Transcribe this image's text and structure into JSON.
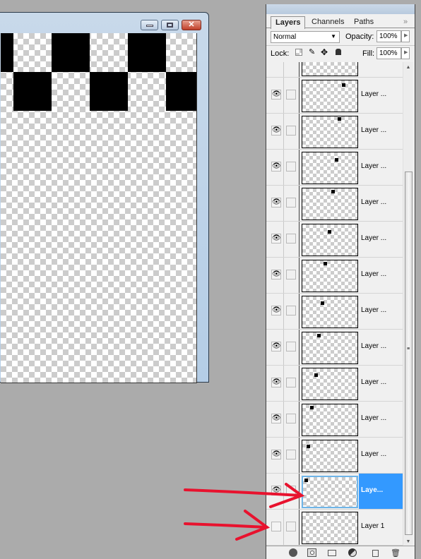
{
  "document_window": {
    "controls": {
      "minimize": "minimize-icon",
      "restore": "restore-icon",
      "close": "close-icon"
    },
    "canvas_pattern": "checkerboard black squares on transparency"
  },
  "layers_panel": {
    "tabs": [
      {
        "label": "Layers",
        "active": true
      },
      {
        "label": "Channels",
        "active": false
      },
      {
        "label": "Paths",
        "active": false
      }
    ],
    "menu_icon": "»",
    "blend_mode": "Normal",
    "opacity_label": "Opacity:",
    "opacity_value": "100%",
    "lock_label": "Lock:",
    "fill_label": "Fill:",
    "fill_value": "100%",
    "layers": [
      {
        "name": "Layer ...",
        "visible": true,
        "selected": false
      },
      {
        "name": "Layer ...",
        "visible": true,
        "selected": false
      },
      {
        "name": "Layer ...",
        "visible": true,
        "selected": false
      },
      {
        "name": "Layer ...",
        "visible": true,
        "selected": false
      },
      {
        "name": "Layer ...",
        "visible": true,
        "selected": false
      },
      {
        "name": "Layer ...",
        "visible": true,
        "selected": false
      },
      {
        "name": "Layer ...",
        "visible": true,
        "selected": false
      },
      {
        "name": "Layer ...",
        "visible": true,
        "selected": false
      },
      {
        "name": "Layer ...",
        "visible": true,
        "selected": false
      },
      {
        "name": "Layer ...",
        "visible": true,
        "selected": false
      },
      {
        "name": "Layer ...",
        "visible": true,
        "selected": false
      },
      {
        "name": "Laye...",
        "visible": true,
        "selected": true
      },
      {
        "name": "Layer 1",
        "visible": false,
        "selected": false
      }
    ],
    "bottom_tools": [
      "link-layers-icon",
      "add-layer-style-icon",
      "add-mask-icon",
      "new-group-icon",
      "adjustment-layer-icon",
      "new-layer-icon",
      "delete-layer-icon"
    ]
  },
  "annotations": {
    "arrows": 2,
    "color": "#e8122e"
  },
  "colors": {
    "selection": "#3399ff",
    "annotation": "#e8122e"
  }
}
